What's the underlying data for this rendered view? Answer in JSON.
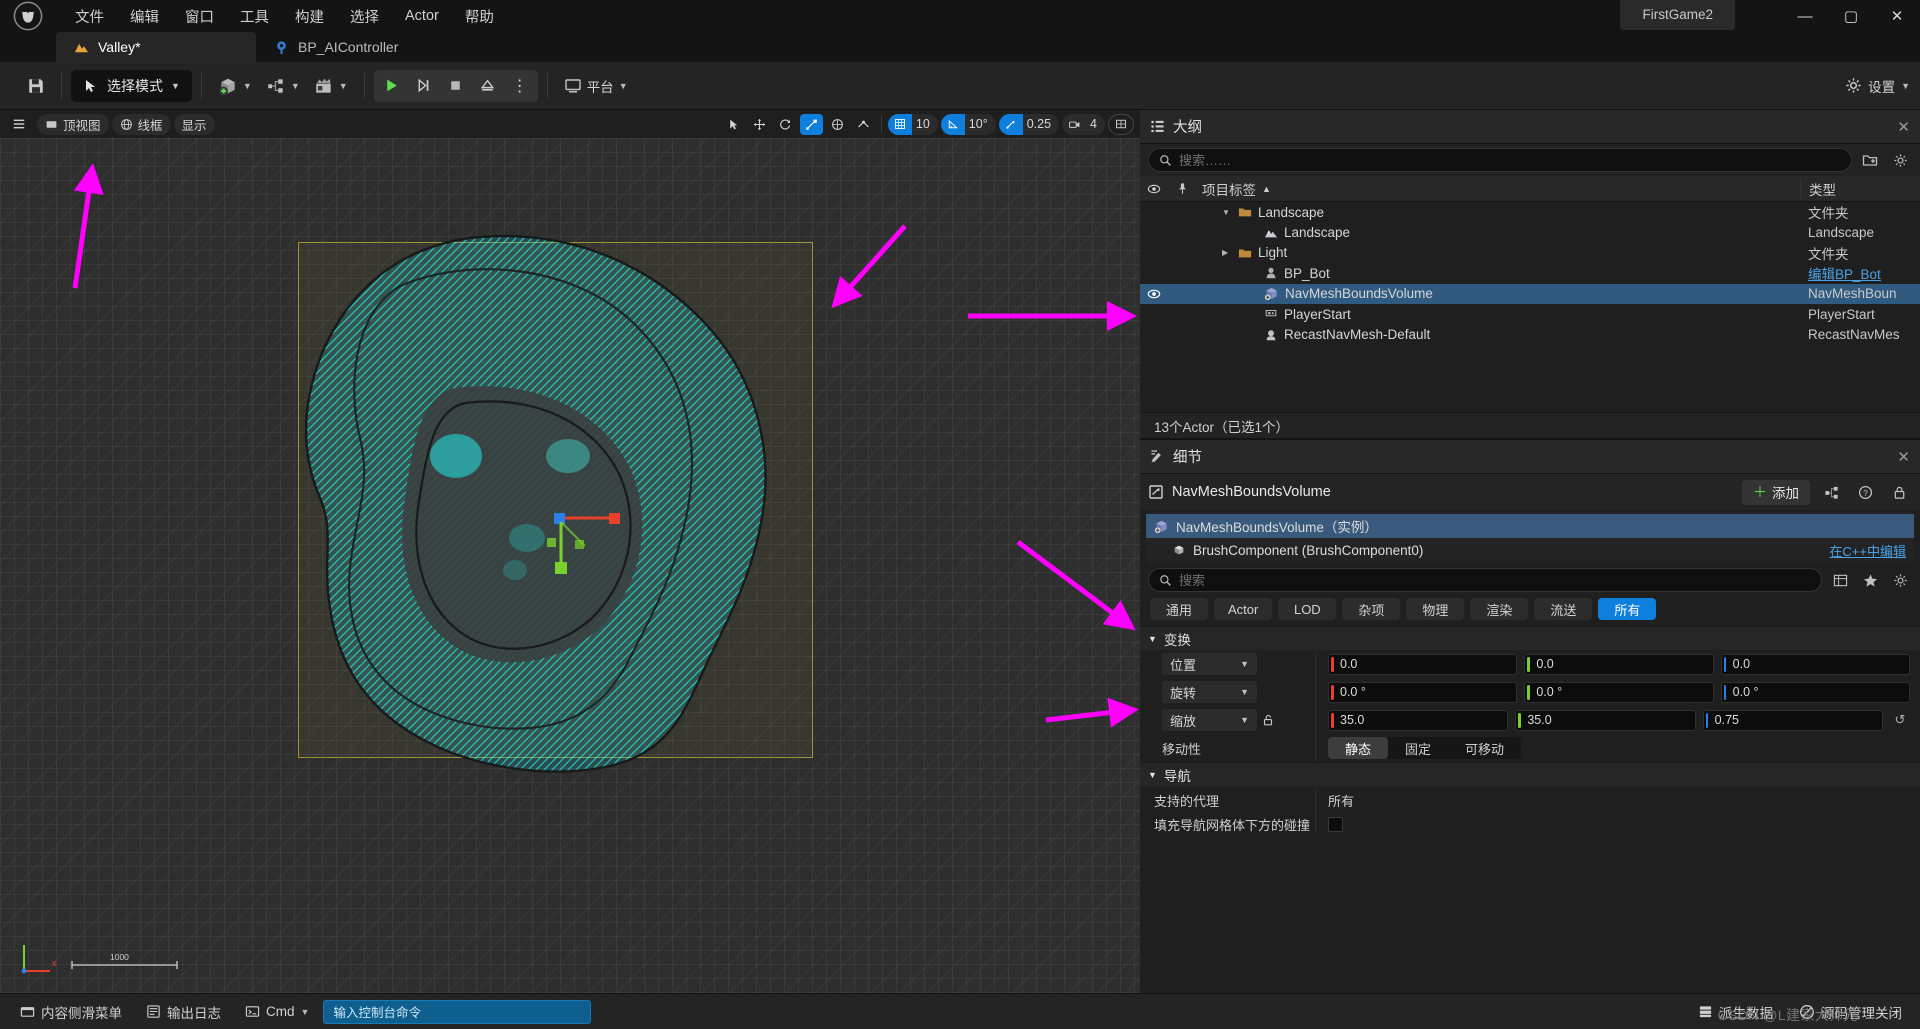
{
  "window": {
    "project_name": "FirstGame2",
    "minimize": "—",
    "maximize": "▢",
    "close": "✕"
  },
  "menu": [
    "文件",
    "编辑",
    "窗口",
    "工具",
    "构建",
    "选择",
    "Actor",
    "帮助"
  ],
  "tabs": [
    {
      "label": "Valley*",
      "icon": "landscape-icon",
      "active": true
    },
    {
      "label": "BP_AIController",
      "icon": "blueprint-icon",
      "active": false
    }
  ],
  "toolbar": {
    "save_icon": "save-icon",
    "mode_label": "选择模式",
    "add_icon": "add-actor-icon",
    "blueprint_icon": "blueprint-dropdown-icon",
    "cinematics_icon": "cinematics-icon",
    "play": "▶",
    "skip": "⏵|",
    "stop": "■",
    "eject": "▲",
    "more": "⋮",
    "platform_label": "平台",
    "settings_label": "设置"
  },
  "viewport": {
    "menu_icon": "viewport-menu-icon",
    "view_mode": "顶视图",
    "shading": "线框",
    "show": "显示",
    "tools": {
      "select_icon": "cursor-select-icon",
      "translate_icon": "translate-gizmo-icon",
      "rotate_icon": "rotate-gizmo-icon",
      "scale_icon": "scale-gizmo-icon",
      "coord_icon": "world-coords-icon",
      "surface_icon": "surface-snap-icon"
    },
    "grid_snap_value": "10",
    "angle_snap_value": "10°",
    "scale_snap_value": "0.25",
    "camera_speed_value": "4",
    "layout_icon": "viewport-layout-icon"
  },
  "outliner": {
    "title": "大纲",
    "close": "✕",
    "search_placeholder": "搜索……",
    "columns": {
      "label": "项目标签",
      "sort": "▲",
      "type": "类型"
    },
    "rows": [
      {
        "name": "Landscape",
        "type": "文件夹",
        "icon": "folder-icon",
        "indent": 1,
        "expander": "▼",
        "visible": false,
        "selected": false,
        "type_link": false
      },
      {
        "name": "Landscape",
        "type": "Landscape",
        "icon": "landscape-icon",
        "indent": 2,
        "expander": "",
        "visible": false,
        "selected": false,
        "type_link": false
      },
      {
        "name": "Light",
        "type": "文件夹",
        "icon": "folder-icon",
        "indent": 1,
        "expander": "▶",
        "visible": false,
        "selected": false,
        "type_link": false
      },
      {
        "name": "BP_Bot",
        "type": "编辑BP_Bot",
        "icon": "pawn-icon",
        "indent": 2,
        "expander": "",
        "visible": false,
        "selected": false,
        "type_link": true
      },
      {
        "name": "NavMeshBoundsVolume",
        "type": "NavMeshBoun",
        "icon": "volume-icon",
        "indent": 2,
        "expander": "",
        "visible": true,
        "selected": true,
        "type_link": false
      },
      {
        "name": "PlayerStart",
        "type": "PlayerStart",
        "icon": "playerstart-icon",
        "indent": 2,
        "expander": "",
        "visible": false,
        "selected": false,
        "type_link": false
      },
      {
        "name": "RecastNavMesh-Default",
        "type": "RecastNavMes",
        "icon": "navmesh-icon",
        "indent": 2,
        "expander": "",
        "visible": false,
        "selected": false,
        "type_link": false
      }
    ],
    "footer": "13个Actor（已选1个）"
  },
  "details": {
    "title": "细节",
    "close": "✕",
    "actor_name": "NavMeshBoundsVolume",
    "add_label": "添加",
    "grid_icon": "component-grid-icon",
    "help_icon": "help-icon",
    "lock_icon": "lock-icon",
    "components": [
      {
        "label": "NavMeshBoundsVolume（实例）",
        "icon": "volume-icon",
        "selected": true,
        "tail": ""
      },
      {
        "label": "BrushComponent (BrushComponent0)",
        "icon": "brush-icon",
        "selected": false,
        "tail": "在C++中编辑"
      }
    ],
    "search_placeholder": "搜索",
    "search_icons": [
      "columns-icon",
      "favorite-star-icon",
      "settings-gear-icon"
    ],
    "filters": [
      {
        "label": "通用",
        "active": false
      },
      {
        "label": "Actor",
        "active": false
      },
      {
        "label": "LOD",
        "active": false
      },
      {
        "label": "杂项",
        "active": false
      },
      {
        "label": "物理",
        "active": false
      },
      {
        "label": "渲染",
        "active": false
      },
      {
        "label": "流送",
        "active": false
      },
      {
        "label": "所有",
        "active": true
      }
    ],
    "transform": {
      "section": "变换",
      "rows": [
        {
          "label": "位置",
          "dropdown": true,
          "values": [
            "0.0",
            "0.0",
            "0.0"
          ],
          "lock": false
        },
        {
          "label": "旋转",
          "dropdown": true,
          "values": [
            "0.0 °",
            "0.0 °",
            "0.0 °"
          ],
          "lock": false
        },
        {
          "label": "缩放",
          "dropdown": true,
          "values": [
            "35.0",
            "35.0",
            "0.75"
          ],
          "lock": true,
          "reset": "↺"
        }
      ],
      "mobility_label": "移动性",
      "mobility": [
        {
          "label": "静态",
          "active": true
        },
        {
          "label": "固定",
          "active": false
        },
        {
          "label": "可移动",
          "active": false
        }
      ]
    },
    "navigation": {
      "section": "导航",
      "rows": [
        {
          "label": "支持的代理",
          "value": "所有",
          "type": "text"
        },
        {
          "label": "填充导航网格体下方的碰撞",
          "value": "",
          "type": "checkbox"
        }
      ]
    }
  },
  "statusbar": {
    "content_drawer": "内容侧滑菜单",
    "output_log": "输出日志",
    "cmd_label": "Cmd",
    "cmd_placeholder": "输入控制台命令",
    "derived_data": "派生数据",
    "source_control": "源码管理关闭",
    "watermark": "CSDN @L建家大师兄"
  },
  "colors": {
    "accent_blue": "#0e7fdc",
    "selection_blue": "#315a80",
    "axis_x": "#e8402a",
    "axis_y": "#7ad12e",
    "axis_z": "#2a7fe8",
    "arrow_magenta": "#ff00ff",
    "navmesh_cyan": "#22e8e8",
    "landscape_yellow": "#9c9433"
  }
}
